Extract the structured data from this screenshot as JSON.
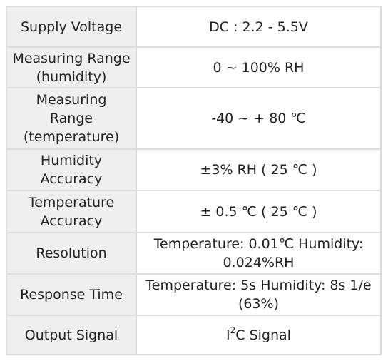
{
  "rows": [
    {
      "label": "Supply Voltage",
      "value": "DC : 2.2 - 5.5V"
    },
    {
      "label": "Measuring Range (humidity)",
      "value": "0 ~ 100% RH"
    },
    {
      "label": "Measuring Range (temperature)",
      "value": "-40 ~ + 80 ℃"
    },
    {
      "label": "Humidity Accuracy",
      "value": "±3% RH ( 25 ℃ )"
    },
    {
      "label": "Temperature Accuracy",
      "value": "± 0.5 ℃ ( 25 ℃ )"
    },
    {
      "label": "Resolution",
      "value": "Temperature: 0.01℃ Humidity: 0.024%RH"
    },
    {
      "label": "Response Time",
      "value": "Temperature: 5s Humidity: 8s 1/e (63%)"
    },
    {
      "label": "Output Signal",
      "value_prefix": "I",
      "value_sup": "2",
      "value_suffix": "C Signal"
    }
  ]
}
